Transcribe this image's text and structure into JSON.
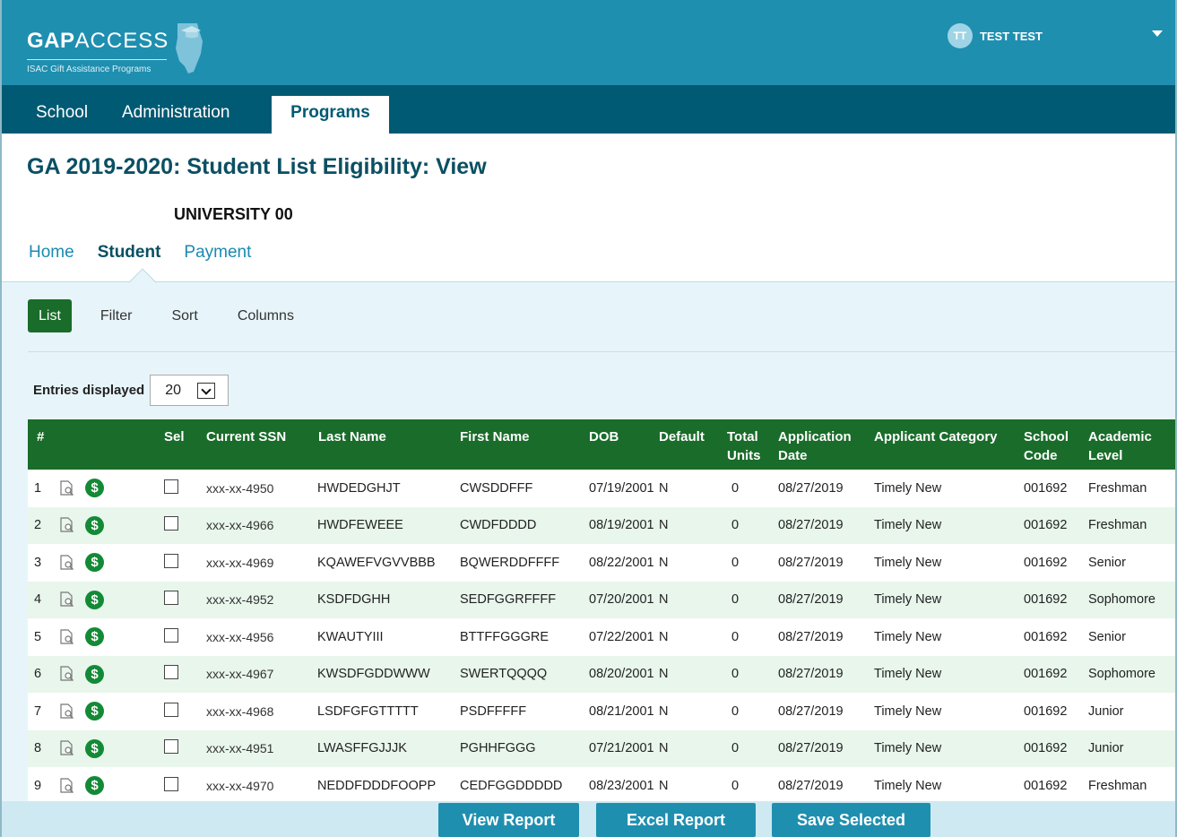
{
  "header": {
    "logo_gap": "GAP",
    "logo_access": "ACCESS",
    "logo_subtitle": "ISAC Gift Assistance Programs",
    "user_initials": "TT",
    "user_name": "TEST TEST"
  },
  "main_nav": {
    "tabs": [
      {
        "label": "School"
      },
      {
        "label": "Administration"
      },
      {
        "label": "Programs",
        "active": true
      }
    ]
  },
  "page": {
    "title": "GA 2019-2020: Student List Eligibility: View",
    "school_name": "UNIVERSITY 00"
  },
  "sub_nav": {
    "items": [
      {
        "label": "Home"
      },
      {
        "label": "Student",
        "active": true
      },
      {
        "label": "Payment"
      }
    ]
  },
  "toolbar": {
    "items": [
      {
        "label": "List",
        "active": true
      },
      {
        "label": "Filter"
      },
      {
        "label": "Sort"
      },
      {
        "label": "Columns"
      }
    ]
  },
  "entries": {
    "label": "Entries displayed",
    "value": "20"
  },
  "table": {
    "headers": {
      "num": "#",
      "sel": "Sel",
      "ssn": "Current SSN",
      "last": "Last Name",
      "first": "First Name",
      "dob": "DOB",
      "default": "Default",
      "units_1": "Total",
      "units_2": "Units",
      "appdate_1": "Application",
      "appdate_2": "Date",
      "category": "Applicant Category",
      "school_1": "School",
      "school_2": "Code",
      "level_1": "Academic",
      "level_2": "Level"
    },
    "rows": [
      {
        "num": "1",
        "ssn": "xxx-xx-4950",
        "last": "HWDEDGHJT",
        "first": "CWSDDFFF",
        "dob": "07/19/2001",
        "default": "N",
        "units": "0",
        "appdate": "08/27/2019",
        "category": "Timely New",
        "school": "001692",
        "level": "Freshman"
      },
      {
        "num": "2",
        "ssn": "xxx-xx-4966",
        "last": "HWDFEWEEE",
        "first": "CWDFDDDD",
        "dob": "08/19/2001",
        "default": "N",
        "units": "0",
        "appdate": "08/27/2019",
        "category": "Timely New",
        "school": "001692",
        "level": "Freshman"
      },
      {
        "num": "3",
        "ssn": "xxx-xx-4969",
        "last": "KQAWEFVGVVBBB",
        "first": "BQWERDDFFFF",
        "dob": "08/22/2001",
        "default": "N",
        "units": "0",
        "appdate": "08/27/2019",
        "category": "Timely New",
        "school": "001692",
        "level": "Senior"
      },
      {
        "num": "4",
        "ssn": "xxx-xx-4952",
        "last": "KSDFDGHH",
        "first": "SEDFGGRFFFF",
        "dob": "07/20/2001",
        "default": "N",
        "units": "0",
        "appdate": "08/27/2019",
        "category": "Timely New",
        "school": "001692",
        "level": "Sophomore"
      },
      {
        "num": "5",
        "ssn": "xxx-xx-4956",
        "last": "KWAUTYIII",
        "first": "BTTFFGGGRE",
        "dob": "07/22/2001",
        "default": "N",
        "units": "0",
        "appdate": "08/27/2019",
        "category": "Timely New",
        "school": "001692",
        "level": "Senior"
      },
      {
        "num": "6",
        "ssn": "xxx-xx-4967",
        "last": "KWSDFGDDWWW",
        "first": "SWERTQQQQ",
        "dob": "08/20/2001",
        "default": "N",
        "units": "0",
        "appdate": "08/27/2019",
        "category": "Timely New",
        "school": "001692",
        "level": "Sophomore"
      },
      {
        "num": "7",
        "ssn": "xxx-xx-4968",
        "last": "LSDFGFGTTTTT",
        "first": "PSDFFFFF",
        "dob": "08/21/2001",
        "default": "N",
        "units": "0",
        "appdate": "08/27/2019",
        "category": "Timely New",
        "school": "001692",
        "level": "Junior"
      },
      {
        "num": "8",
        "ssn": "xxx-xx-4951",
        "last": "LWASFFGJJJK",
        "first": "PGHHFGGG",
        "dob": "07/21/2001",
        "default": "N",
        "units": "0",
        "appdate": "08/27/2019",
        "category": "Timely New",
        "school": "001692",
        "level": "Junior"
      },
      {
        "num": "9",
        "ssn": "xxx-xx-4970",
        "last": "NEDDFDDDFOOPP",
        "first": "CEDFGGDDDDD",
        "dob": "08/23/2001",
        "default": "N",
        "units": "0",
        "appdate": "08/27/2019",
        "category": "Timely New",
        "school": "001692",
        "level": "Freshman"
      }
    ]
  },
  "actions": {
    "view_report": "View Report",
    "excel_report": "Excel Report",
    "save_selected": "Save Selected"
  },
  "colors": {
    "header_blue": "#1f8fb0",
    "nav_dark": "#005a73",
    "table_green": "#1a6c2a",
    "panel_light": "#e7f5fa"
  }
}
